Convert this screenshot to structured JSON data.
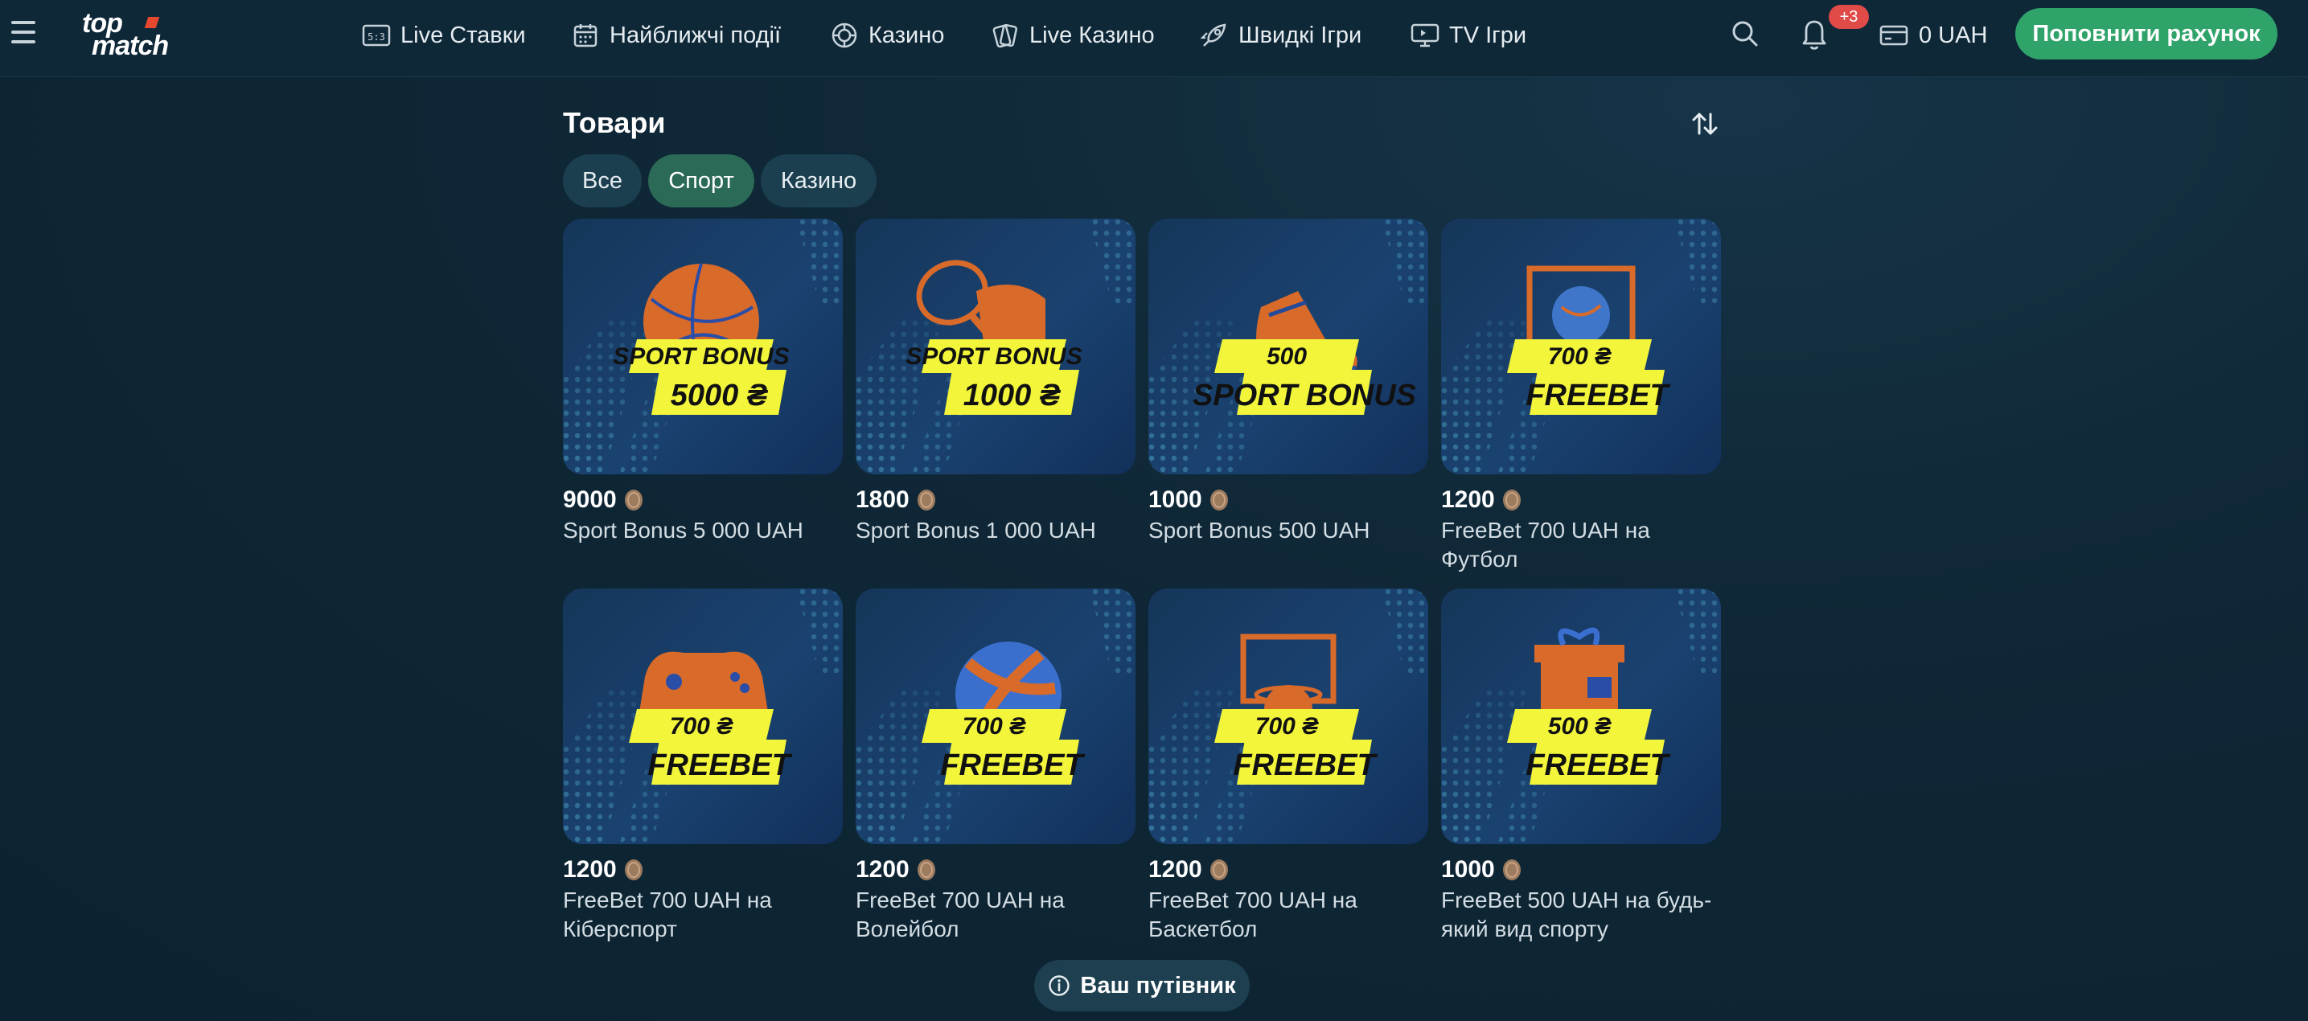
{
  "header": {
    "logo_line1": "top",
    "logo_line2": "match",
    "nav": [
      {
        "label": "Live Ставки",
        "icon": "scoreboard-icon"
      },
      {
        "label": "Найближчі події",
        "icon": "calendar-icon"
      },
      {
        "label": "Казино",
        "icon": "casino-chip-icon"
      },
      {
        "label": "Live Казино",
        "icon": "cards-icon"
      },
      {
        "label": "Швидкі Ігри",
        "icon": "rocket-icon"
      },
      {
        "label": "TV Ігри",
        "icon": "tv-icon"
      }
    ],
    "scoreboard_text": "5:3",
    "notifications_badge": "+3",
    "balance": "0 UAH",
    "deposit_label": "Поповнити рахунок"
  },
  "store": {
    "title": "Товари",
    "filters": [
      {
        "label": "Все",
        "active": false
      },
      {
        "label": "Спорт",
        "active": true
      },
      {
        "label": "Казино",
        "active": false
      }
    ],
    "items": [
      {
        "price": "9000",
        "name": "Sport Bonus 5 000 UAH",
        "art": "ball",
        "banner": [
          "SPORT BONUS",
          "5000 ₴"
        ]
      },
      {
        "price": "1800",
        "name": "Sport Bonus 1 000 UAH",
        "art": "racket-glove",
        "banner": [
          "SPORT BONUS",
          "1000 ₴"
        ]
      },
      {
        "price": "1000",
        "name": "Sport Bonus 500 UAH",
        "art": "boot",
        "banner": [
          "500",
          "SPORT BONUS"
        ]
      },
      {
        "price": "1200",
        "name": "FreeBet 700 UAH на Футбол",
        "art": "goal",
        "banner": [
          "700 ₴",
          "FREEBET"
        ]
      },
      {
        "price": "1200",
        "name": "FreeBet 700 UAH на Кіберспорт",
        "art": "gamepad",
        "banner": [
          "700 ₴",
          "FREEBET"
        ]
      },
      {
        "price": "1200",
        "name": "FreeBet 700 UAH на Волейбол",
        "art": "volleyball",
        "banner": [
          "700 ₴",
          "FREEBET"
        ]
      },
      {
        "price": "1200",
        "name": "FreeBet 700 UAH на Баскетбол",
        "art": "hoop",
        "banner": [
          "700 ₴",
          "FREEBET"
        ]
      },
      {
        "price": "1000",
        "name": "FreeBet 500 UAH на будь-який вид спорту",
        "art": "gift",
        "banner": [
          "500 ₴",
          "FREEBET"
        ]
      }
    ]
  },
  "guide_label": "Ваш путівник",
  "colors": {
    "accent": "#2fa36a",
    "chip_active": "#2b6a57",
    "banner_yellow": "#f2f53a",
    "badge_red": "#e04b48",
    "prize_orange": "#d86a2a"
  }
}
